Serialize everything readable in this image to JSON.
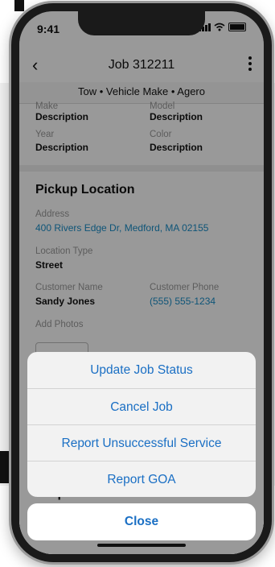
{
  "status_bar": {
    "time": "9:41"
  },
  "nav": {
    "title": "Job 312211"
  },
  "subheader": {
    "text": "Tow • Vehicle Make • Agero"
  },
  "vehicle": {
    "make_label": "Make",
    "make_value": "Description",
    "model_label": "Model",
    "model_value": "Description",
    "year_label": "Year",
    "year_value": "Description",
    "color_label": "Color",
    "color_value": "Description"
  },
  "pickup": {
    "title": "Pickup Location",
    "address_label": "Address",
    "address_value": "400 Rivers Edge Dr, Medford, MA 02155",
    "location_type_label": "Location Type",
    "location_type_value": "Street",
    "customer_name_label": "Customer Name",
    "customer_name_value": "Sandy Jones",
    "customer_phone_label": "Customer Phone",
    "customer_phone_value": "(555) 555-1234",
    "add_photos_label": "Add Photos"
  },
  "dropoff": {
    "title": "Drop Off Location"
  },
  "action_sheet": {
    "items": [
      {
        "label": "Update Job Status"
      },
      {
        "label": "Cancel Job"
      },
      {
        "label": "Report Unsuccessful Service"
      },
      {
        "label": "Report GOA"
      }
    ],
    "close_label": "Close"
  },
  "colors": {
    "accent": "#1a6fc4",
    "link": "#1a8ec9"
  }
}
